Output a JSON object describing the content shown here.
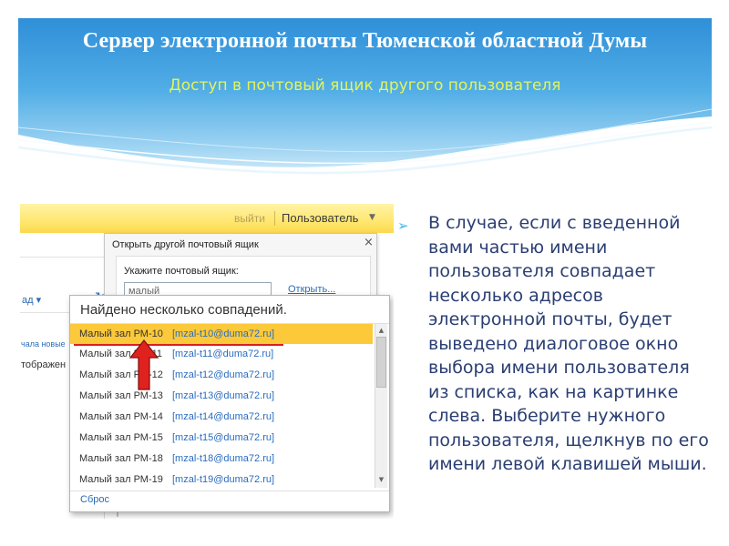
{
  "slide": {
    "title": "Сервер электронной почты Тюменской областной Думы",
    "subtitle": "Доступ в почтовый ящик другого пользователя",
    "bullet_icon": "arrow-bullet-icon",
    "paragraph": "В случае, если с введенной вами частью имени пользователя совпадает несколько адресов электронной почты, будет выведено диалоговое окно выбора имени пользователя из списка, как на картинке слева. Выберите нужного пользователя, щелкнув по его имени левой клавишей мыши."
  },
  "ribbon": {
    "logout": "выйти",
    "user_menu": "Пользователь",
    "user_chevron": "▼"
  },
  "left_pane": {
    "dropdown_fragment": "ад ▾",
    "start_fragment": "чала новые",
    "display_fragment": "тображен"
  },
  "dialog": {
    "title": "Открыть другой почтовый ящик",
    "close": "×",
    "label": "Укажите почтовый ящик:",
    "input_value": "малый",
    "open_link": "Открыть..."
  },
  "matches": {
    "header": "Найдено несколько совпадений.",
    "reset": "Сброс",
    "items": [
      {
        "name": "Малый зал РМ-10",
        "email": "[mzal-t10@duma72.ru]"
      },
      {
        "name": "Малый зал РМ-11",
        "email": "[mzal-t11@duma72.ru]"
      },
      {
        "name": "Малый зал РМ-12",
        "email": "[mzal-t12@duma72.ru]"
      },
      {
        "name": "Малый зал РМ-13",
        "email": "[mzal-t13@duma72.ru]"
      },
      {
        "name": "Малый зал РМ-14",
        "email": "[mzal-t14@duma72.ru]"
      },
      {
        "name": "Малый зал РМ-15",
        "email": "[mzal-t15@duma72.ru]"
      },
      {
        "name": "Малый зал РМ-18",
        "email": "[mzal-t18@duma72.ru]"
      },
      {
        "name": "Малый зал РМ-19",
        "email": "[mzal-t19@duma72.ru]"
      }
    ],
    "selected_index": 0
  },
  "colors": {
    "title": "#ffffff",
    "subtitle": "#e3f45a",
    "body_text": "#2a3e72",
    "selected_row": "#fbc93a",
    "arrow": "#e0221f",
    "link": "#2a6cc0"
  }
}
